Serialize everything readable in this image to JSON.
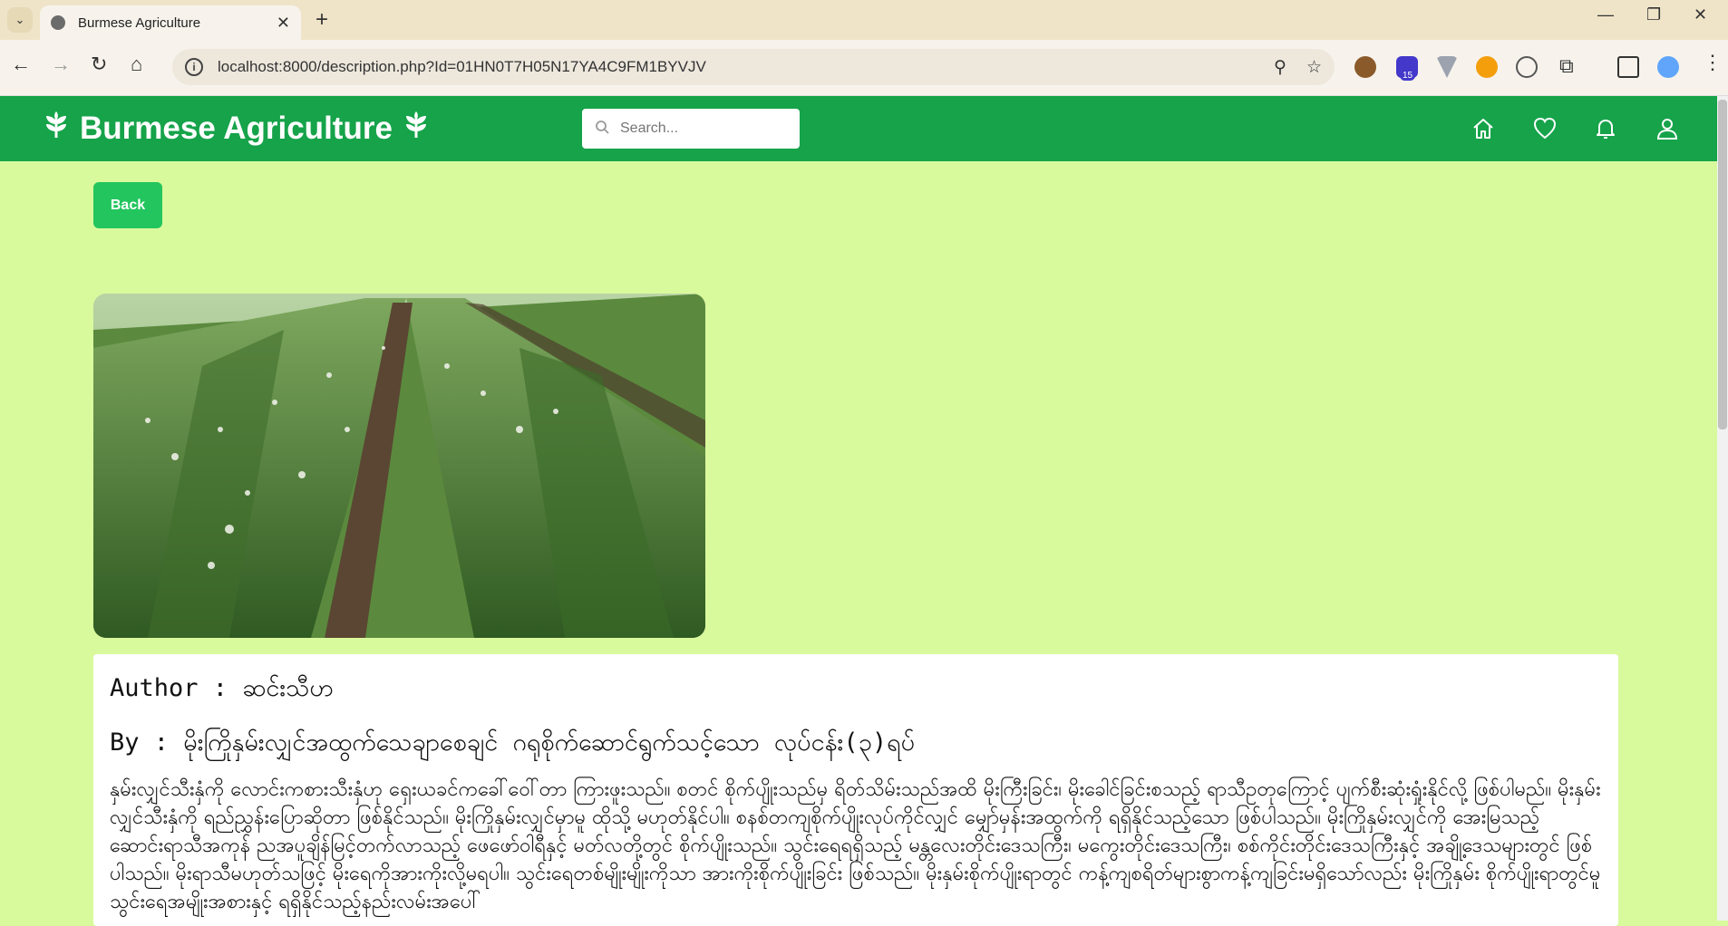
{
  "browser": {
    "tab_title": "Burmese Agriculture",
    "url": "localhost:8000/description.php?Id=01HN0T7H05N17YA4C9FM1BYVJV",
    "extension_badge": "15"
  },
  "header": {
    "brand": "Burmese Agriculture",
    "search_placeholder": "Search..."
  },
  "page": {
    "back_label": "Back",
    "author_line": "Author : ဆင်းသီဟ",
    "by_line": "By : မိုးကြိုနှမ်းလျှင်အထွက်သေချာစေချင် ဂရုစိုက်ဆောင်ရွက်သင့်သော လုပ်ငန်း(၃)ရပ်",
    "description": "နှမ်းလျှင်သီးနှံကို လောင်းကစားသီးနှံဟု ရှေးယခင်ကခေါ်ဝေါ်တာ ကြားဖူးသည်။ စတင် စိုက်ပျိုးသည်မှ ရိတ်သိမ်းသည်အထိ မိုးကြီးခြင်း၊ မိုးခေါင်ခြင်းစသည့် ရာသီဥတုကြောင့် ပျက်စီးဆုံးရှုံးနိုင်လို့ ဖြစ်ပါမည်။ မိုးနှမ်းလျှင်သီးနှံကို ရည်ညွှန်းပြောဆိုတာ ဖြစ်နိုင်သည်။ မိုးကြိုနှမ်းလျှင်မှာမူ ထိုသို့ မဟုတ်နိုင်ပါ။ စနစ်တကျစိုက်ပျိုးလုပ်ကိုင်လျှင် မျှော်မှန်းအထွက်ကို ရရှိနိုင်သည့်သော ဖြစ်ပါသည်။ မိုးကြိုနှမ်းလျှင်ကို အေးမြသည့် ဆောင်းရာသီအကုန် ညအပူချိန်မြင့်တက်လာသည့် ဖေဖော်ဝါရီနှင့် မတ်လတို့တွင် စိုက်ပျိုးသည်။ သွင်းရေရရှိသည့် မန္တလေးတိုင်းဒေသကြီး၊ မကွေးတိုင်းဒေသကြီး၊ စစ်ကိုင်းတိုင်းဒေသကြီးနှင့် အချို့ဒေသများတွင် ဖြစ်ပါသည်။ မိုးရာသီမဟုတ်သဖြင့် မိုးရေကိုအားကိုးလို့မရပါ။ သွင်းရေတစ်မျိုးမျိုးကိုသာ အားကိုးစိုက်ပျိုးခြင်း ဖြစ်သည်။ မိုးနှမ်းစိုက်ပျိုးရာတွင် ကန့်ကျစရိတ်များစွာကန့်ကျခြင်းမရှိသော်လည်း မိုးကြိုနှမ်း စိုက်ပျိုးရာတွင်မူ သွင်းရေအမျိုးအစားနှင့် ရရှိနိုင်သည့်နည်းလမ်းအပေါ်"
  },
  "colors": {
    "page_bg": "#d9f99d",
    "header_bg": "#16a34a",
    "button_bg": "#22c55e"
  },
  "icons": [
    "home-icon",
    "heart-icon",
    "bell-icon",
    "user-icon",
    "leaf-icon",
    "search-icon"
  ]
}
